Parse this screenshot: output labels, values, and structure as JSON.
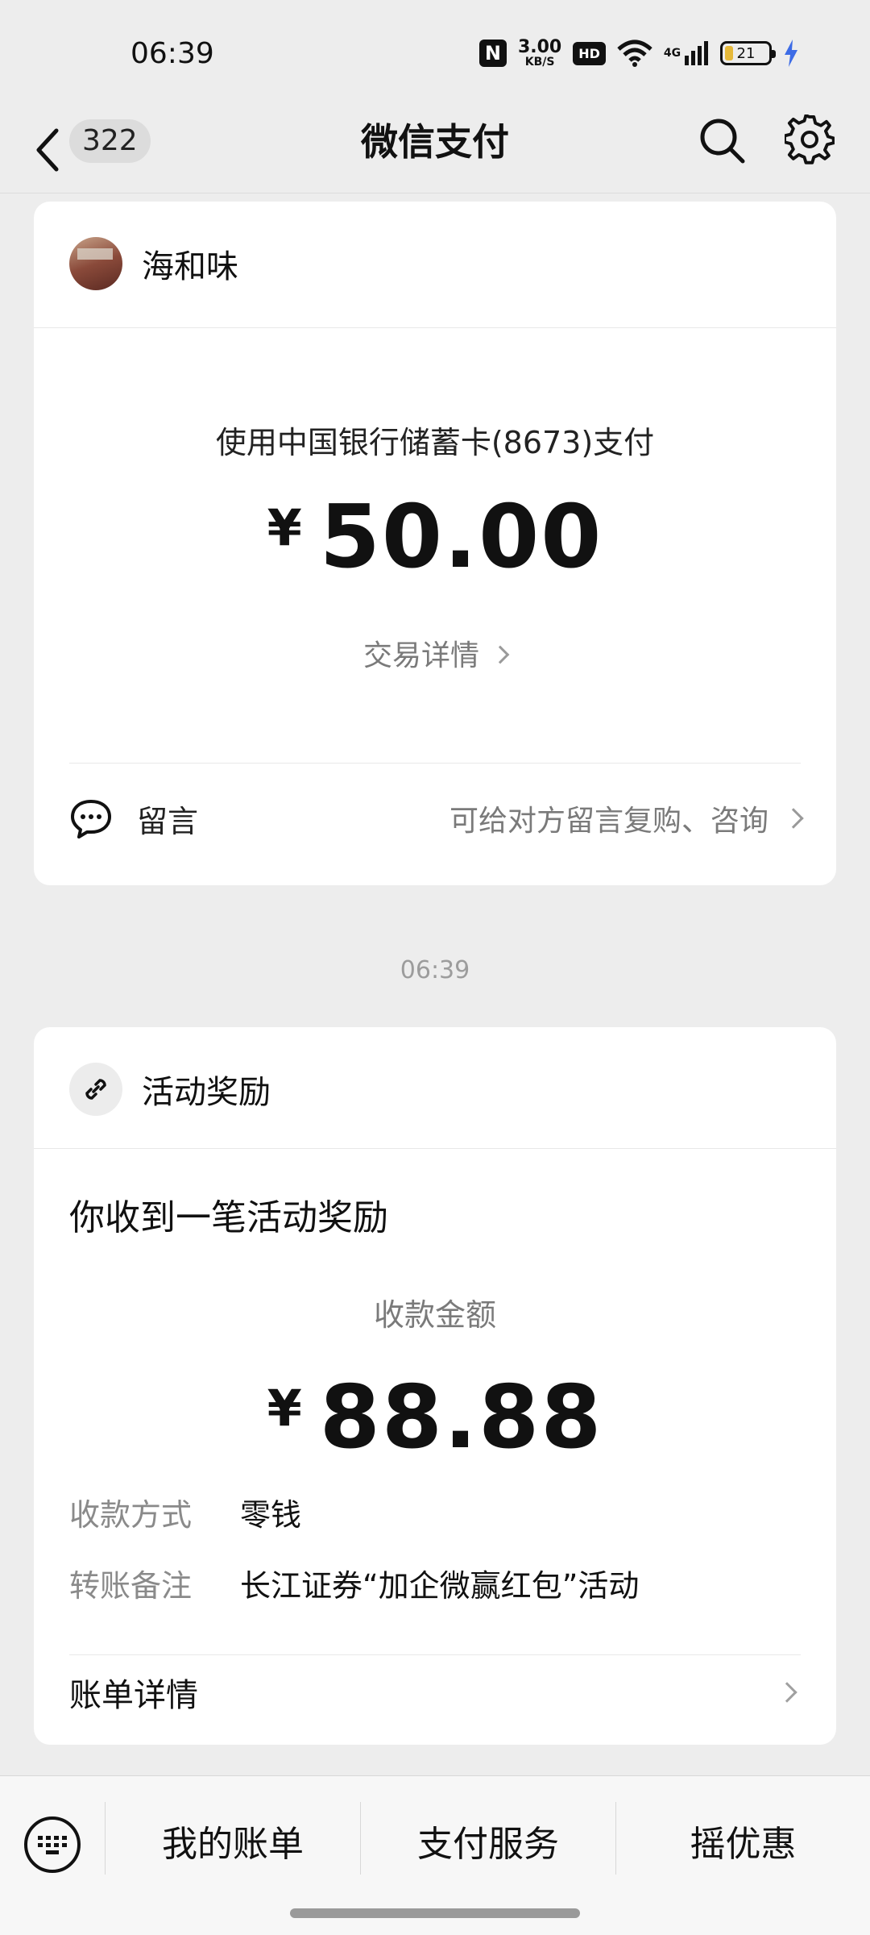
{
  "status_bar": {
    "time": "06:39",
    "speed_value": "3.00",
    "speed_unit": "KB/S",
    "hd": "HD",
    "network": "4G",
    "battery": "21"
  },
  "header": {
    "back_count": "322",
    "title": "微信支付"
  },
  "payment_card": {
    "merchant": "海和味",
    "pay_method": "使用中国银行储蓄卡(8673)支付",
    "currency": "¥",
    "amount": "50.00",
    "detail_link": "交易详情",
    "message_label": "留言",
    "message_hint": "可给对方留言复购、咨询"
  },
  "timestamp": "06:39",
  "reward_card": {
    "title": "活动奖励",
    "headline": "你收到一笔活动奖励",
    "amount_label": "收款金额",
    "currency": "¥",
    "amount": "88.88",
    "fields": [
      {
        "key": "收款方式",
        "value": "零钱"
      },
      {
        "key": "转账备注",
        "value": "长江证券“加企微赢红包”活动"
      }
    ],
    "bill_link": "账单详情"
  },
  "bottom_menu": {
    "items": [
      "我的账单",
      "支付服务",
      "摇优惠"
    ]
  },
  "icons": {
    "back": "chevron-left-icon",
    "search": "search-icon",
    "settings": "gear-icon",
    "message": "chat-bubble-icon",
    "link": "link-icon",
    "keyboard": "keyboard-icon"
  }
}
